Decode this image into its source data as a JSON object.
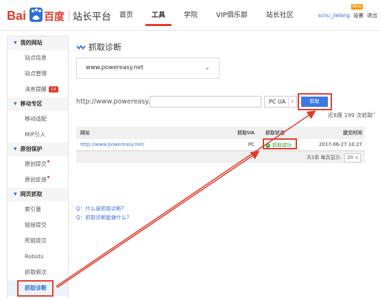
{
  "header": {
    "logo_text": "Bai百度",
    "site_title": "站长平台",
    "nav": [
      "首页",
      "工具",
      "学院",
      "VIP俱乐部",
      "站长社区"
    ],
    "active_nav": "工具",
    "user": {
      "name": "scnu_jielang",
      "settings": "设置",
      "logout": "退出",
      "new_badge": "New"
    }
  },
  "sidebar": {
    "groups": [
      {
        "title": "我的网站",
        "items": [
          {
            "label": "站点信息"
          },
          {
            "label": "站点管理"
          },
          {
            "label": "消息提醒",
            "badge": "14"
          }
        ]
      },
      {
        "title": "移动专区",
        "items": [
          {
            "label": "移动适配"
          },
          {
            "label": "MIP引入"
          }
        ]
      },
      {
        "title": "原创保护",
        "items": [
          {
            "label": "原创提交",
            "dot": true
          },
          {
            "label": "原创反馈",
            "dot": true
          }
        ]
      },
      {
        "title": "网页抓取",
        "items": [
          {
            "label": "索引量"
          },
          {
            "label": "链接提交"
          },
          {
            "label": "死链提交"
          },
          {
            "label": "Robots"
          },
          {
            "label": "抓取频次"
          },
          {
            "label": "抓取诊断",
            "active": true
          }
        ]
      }
    ]
  },
  "main": {
    "title": "抓取诊断",
    "site_select": {
      "value": "www.powereasy.net"
    },
    "url_prefix": "http://www.powereasy.net/",
    "url_input": {
      "value": "",
      "placeholder": ""
    },
    "ua_select": {
      "value": "PC UA"
    },
    "fetch_button": "抓取",
    "recent_count": "近8周 199 次抓取",
    "table": {
      "headers": {
        "url": "网址",
        "ua": "抓取UA",
        "status": "抓取状态",
        "time": "提交时间"
      },
      "rows": [
        {
          "url": "http://www.powereasy.net/",
          "ua": "PC",
          "status": "抓取成功",
          "time": "2017-06-27 10:27"
        }
      ],
      "footer": {
        "summary": "共1条 每页显示:",
        "page_size": "20"
      }
    },
    "help_links": [
      "Q：什么是抓取诊断?",
      "Q：抓取诊断能做什么?"
    ]
  },
  "colors": {
    "accent_red": "#e03a2b",
    "link_blue": "#3a6fd8",
    "button_blue": "#3b7be0",
    "success_green": "#4caf50"
  },
  "icons": {
    "status_success": "check-circle-icon",
    "dropdown": "chevron-down-icon",
    "title": "wave-icon"
  }
}
